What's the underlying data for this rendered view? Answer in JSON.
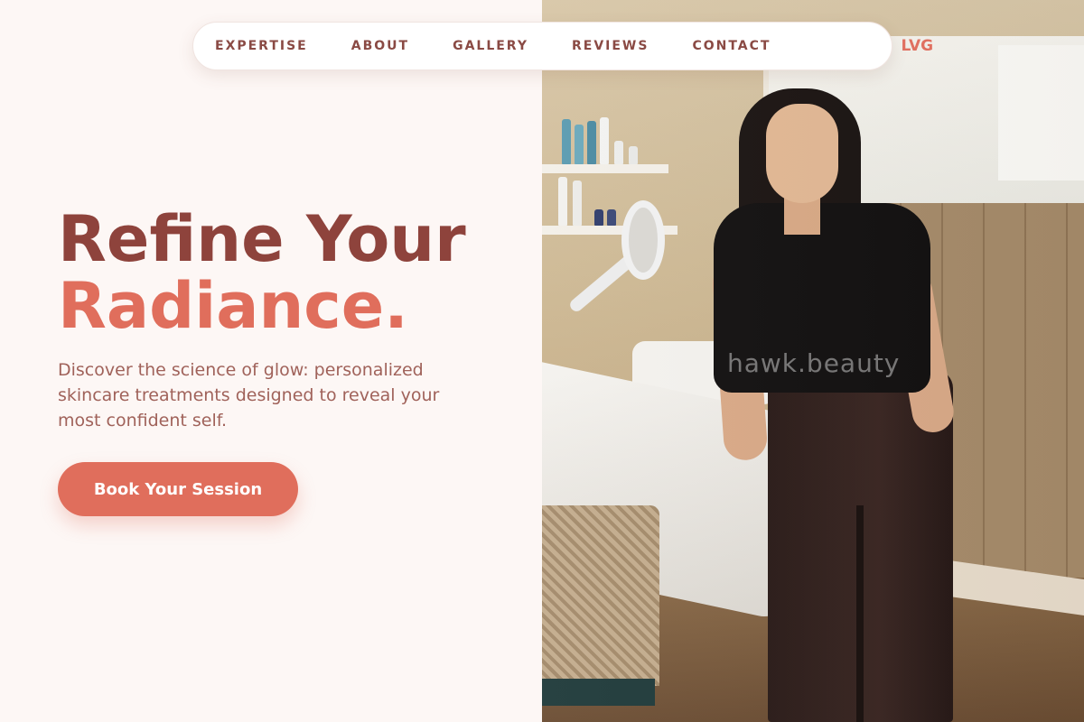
{
  "nav": {
    "links": [
      {
        "label": "EXPERTISE"
      },
      {
        "label": "ABOUT"
      },
      {
        "label": "GALLERY"
      },
      {
        "label": "REVIEWS"
      },
      {
        "label": "CONTACT"
      }
    ],
    "logo": "LVG"
  },
  "hero": {
    "title_line1": "Refine Your",
    "title_line2": "Radiance.",
    "subtitle": "Discover the science of glow: personalized skincare treatments designed to reveal your most confident self.",
    "cta_label": "Book Your Session"
  },
  "photo": {
    "watermark": "hawk.beauty"
  },
  "colors": {
    "background": "#fdf7f5",
    "title_dark": "#8e433c",
    "accent": "#e06e5c",
    "body_text": "#a0625a",
    "nav_text": "#8a4a44"
  }
}
